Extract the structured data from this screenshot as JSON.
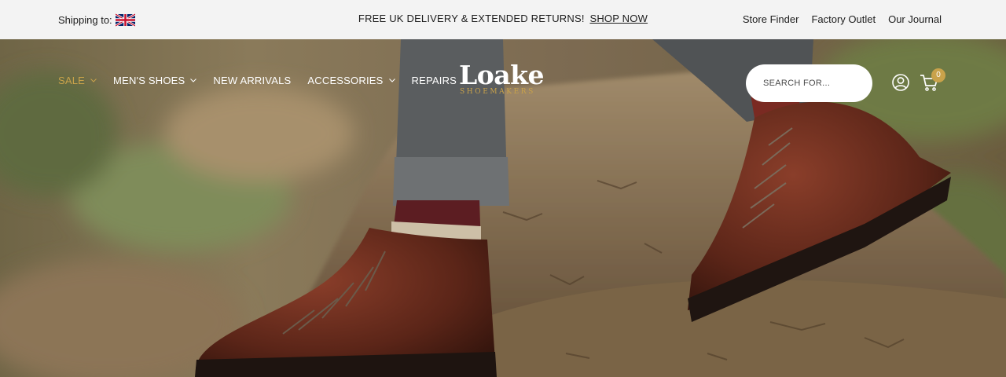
{
  "topbar": {
    "shipping_label": "Shipping to:",
    "promo_text": "FREE UK DELIVERY & EXTENDED RETURNS!",
    "promo_link": "SHOP NOW",
    "links": [
      "Store Finder",
      "Factory Outlet",
      "Our Journal"
    ]
  },
  "nav": {
    "items": [
      {
        "label": "SALE",
        "has_dropdown": true
      },
      {
        "label": "MEN'S SHOES",
        "has_dropdown": true
      },
      {
        "label": "NEW ARRIVALS",
        "has_dropdown": false
      },
      {
        "label": "ACCESSORIES",
        "has_dropdown": true
      },
      {
        "label": "REPAIRS",
        "has_dropdown": false
      }
    ]
  },
  "logo": {
    "main": "Loake",
    "sub": "SHOEMAKERS"
  },
  "search": {
    "placeholder": "SEARCH FOR..."
  },
  "cart": {
    "count": "0"
  },
  "icons": {
    "flag": "uk-flag-icon",
    "account": "account-icon",
    "cart": "cart-icon",
    "chevron": "chevron-down-icon"
  },
  "colors": {
    "accent": "#c9a24a",
    "topbar_bg": "#f3f3f3",
    "nav_text": "#ffffff"
  }
}
